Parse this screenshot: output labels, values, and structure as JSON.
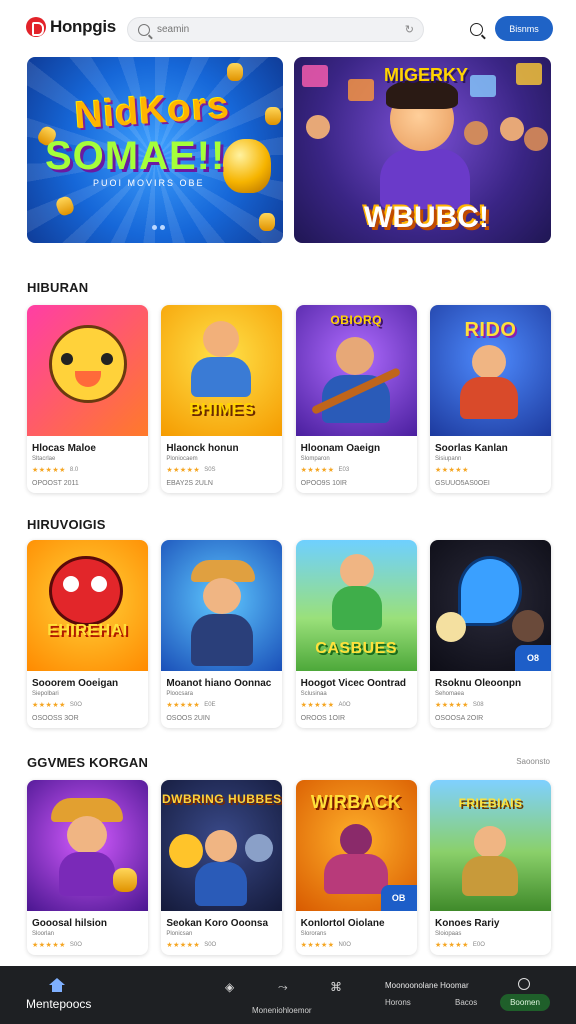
{
  "header": {
    "logo_text": "Honpgis",
    "search_placeholder": "seamin",
    "cta_label": "Bisnms"
  },
  "banners": [
    {
      "title_line1": "NidKors",
      "title_line2": "SOMAE!!",
      "subtitle": "PUOI MOVIRS OBE",
      "page_dots": 2
    },
    {
      "title_top": "MIGERKY",
      "title_bottom": "WBUBC!"
    }
  ],
  "sections": [
    {
      "title": "HIBURAN",
      "cards": [
        {
          "name": "Hlocas Maloe",
          "sub": "Sltacrlae",
          "rating": "8.0",
          "meta": "OPOOST 2011",
          "art_text": ""
        },
        {
          "name": "Hlaonck honun",
          "sub": "Ploniocaem",
          "rating": "S0S",
          "meta": "EBAY2S 2ULN",
          "art_text": "BHIMES"
        },
        {
          "name": "Hloonam Oaeign",
          "sub": "Slomparon",
          "rating": "E03",
          "meta": "OPOO9S 10IR",
          "art_text": "OBIORQ"
        },
        {
          "name": "Soorlas Kanlan",
          "sub": "Sisiupann",
          "rating": "",
          "meta": "GSUUO5AS0OEI",
          "art_text": "RIDO"
        }
      ]
    },
    {
      "title": "HIRUVOIGIS",
      "cards": [
        {
          "name": "Sooorem Ooeigan",
          "sub": "Siepolbari",
          "rating": "S0O",
          "meta": "OSOOSS 3OR",
          "art_text": "EHIREHAI"
        },
        {
          "name": "Moanot hiano Oonnac",
          "sub": "Ploocsara",
          "rating": "E0E",
          "meta": "OSOOS 2UIN",
          "art_text": ""
        },
        {
          "name": "Hoogot Vicec Oontrad",
          "sub": "Sclusinaa",
          "rating": "A0O",
          "meta": "OROOS 1OIR",
          "art_text": "CASBUES"
        },
        {
          "name": "Rsoknu Oleoonpn",
          "sub": "Sehomaea",
          "rating": "S08",
          "meta": "OSOOSA 2OIR",
          "art_text": "",
          "badge": "O8"
        }
      ]
    },
    {
      "title": "GGVMES KORGAN",
      "see_all": "Saoonsto",
      "cards": [
        {
          "name": "Gooosal hilsion",
          "sub": "Sloorlan",
          "rating": "S0O",
          "meta": "",
          "art_text": ""
        },
        {
          "name": "Seokan Koro Ooonsa",
          "sub": "Plonicsan",
          "rating": "S0O",
          "meta": "",
          "art_text": "DWBRING HUBBES"
        },
        {
          "name": "Konlortol Oiolane",
          "sub": "Slororans",
          "rating": "N0O",
          "meta": "",
          "art_text": "WIRBACK",
          "badge": "OB"
        },
        {
          "name": "Konoes Rariy",
          "sub": "Sloiopaas",
          "rating": "E0O",
          "meta": "",
          "art_text": "FRIEBIAIS"
        }
      ]
    }
  ],
  "bottom_nav": {
    "home_label": "Mentepoocs",
    "center_label": "Moneniohloemor",
    "right_top": "Moonoonolane Hoomar",
    "right_bottom_left": "Horons",
    "right_bottom_mid": "Bacos",
    "pill_label": "Boomen"
  },
  "colors": {
    "accent": "#1f63c6",
    "nav_bg": "#1e2023",
    "star": "#f5a623"
  }
}
